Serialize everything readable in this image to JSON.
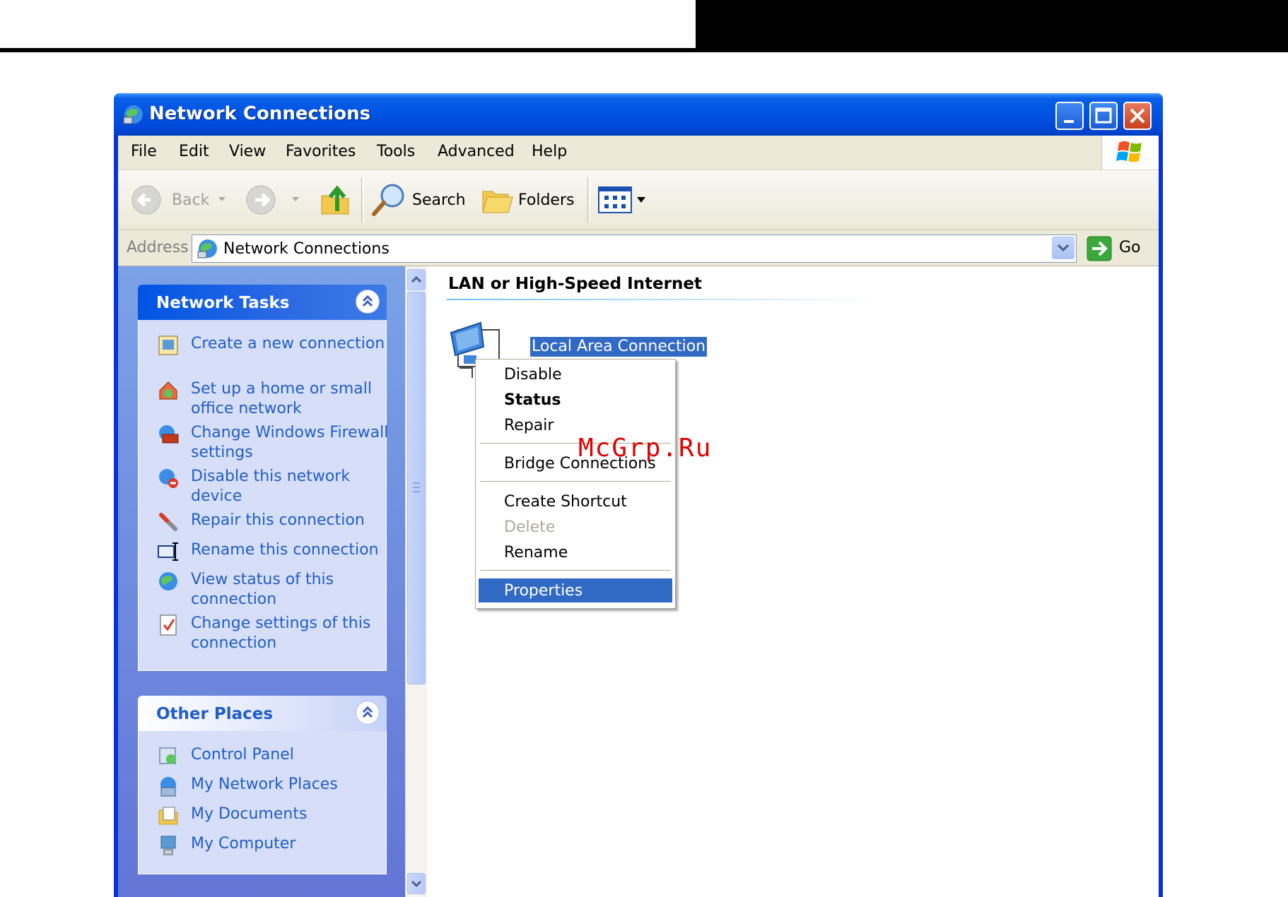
{
  "window": {
    "title": "Network Connections"
  },
  "menubar": {
    "items": [
      "File",
      "Edit",
      "View",
      "Favorites",
      "Tools",
      "Advanced",
      "Help"
    ]
  },
  "toolbar": {
    "back_label": "Back",
    "search_label": "Search",
    "folders_label": "Folders"
  },
  "address": {
    "label": "Address",
    "value": "Network Connections",
    "go_label": "Go"
  },
  "network_tasks": {
    "title": "Network Tasks",
    "items": [
      {
        "label": "Create a new connection",
        "icon": "new-connection-icon"
      },
      {
        "label": "Set up a home or small office network",
        "icon": "home-network-icon"
      },
      {
        "label": "Change Windows Firewall settings",
        "icon": "firewall-icon"
      },
      {
        "label": "Disable this network device",
        "icon": "disable-device-icon"
      },
      {
        "label": "Repair this connection",
        "icon": "repair-icon"
      },
      {
        "label": "Rename this connection",
        "icon": "rename-icon"
      },
      {
        "label": "View status of this connection",
        "icon": "status-icon"
      },
      {
        "label": "Change settings of this connection",
        "icon": "settings-icon"
      }
    ]
  },
  "other_places": {
    "title": "Other Places",
    "items": [
      {
        "label": "Control Panel",
        "icon": "control-panel-icon"
      },
      {
        "label": "My Network Places",
        "icon": "network-places-icon"
      },
      {
        "label": "My Documents",
        "icon": "documents-icon"
      },
      {
        "label": "My Computer",
        "icon": "computer-icon"
      }
    ]
  },
  "content": {
    "group_title": "LAN or High-Speed Internet",
    "connection_label": "Local Area Connection"
  },
  "context_menu": {
    "items": [
      {
        "label": "Disable"
      },
      {
        "label": "Status",
        "bold": true
      },
      {
        "label": "Repair"
      },
      {
        "label": "Bridge Connections"
      },
      {
        "label": "Create Shortcut"
      },
      {
        "label": "Delete",
        "disabled": true
      },
      {
        "label": "Rename"
      },
      {
        "label": "Properties",
        "selected": true
      }
    ]
  },
  "watermark": "McGrp.Ru",
  "colors": {
    "title_blue": "#0054e3",
    "selection": "#316ac5",
    "task_link": "#215dc6"
  }
}
